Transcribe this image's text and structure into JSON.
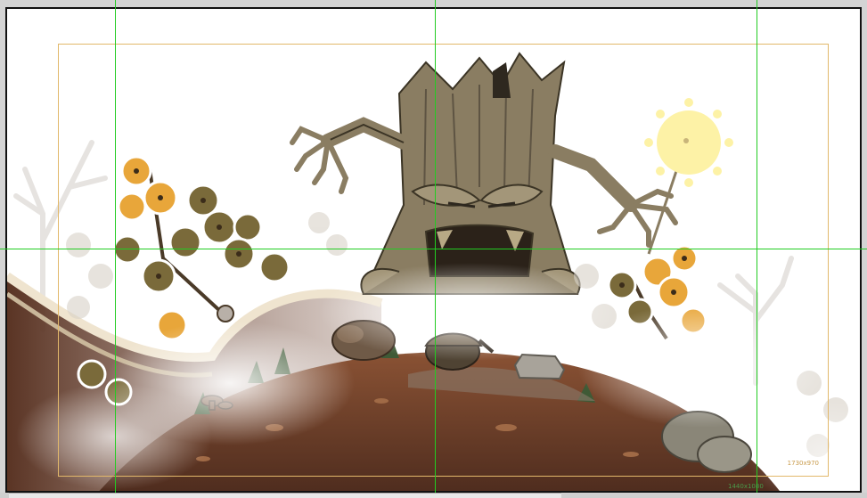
{
  "editor": {
    "canvas_label_outer": "1730x970",
    "canvas_label_inner": "1440x1080"
  },
  "scene": {
    "subjects": [
      "haunted-tree-monster",
      "sun",
      "acorn",
      "hill",
      "flowers",
      "mist"
    ]
  },
  "colors": {
    "guide_green": "#22cc22",
    "guide_orange": "#e2b86a",
    "hill_brown": "#6b3f2a",
    "trunk": "#8a7d62",
    "flower_yellow": "#e8a63a",
    "sun": "#fdf2a6"
  }
}
